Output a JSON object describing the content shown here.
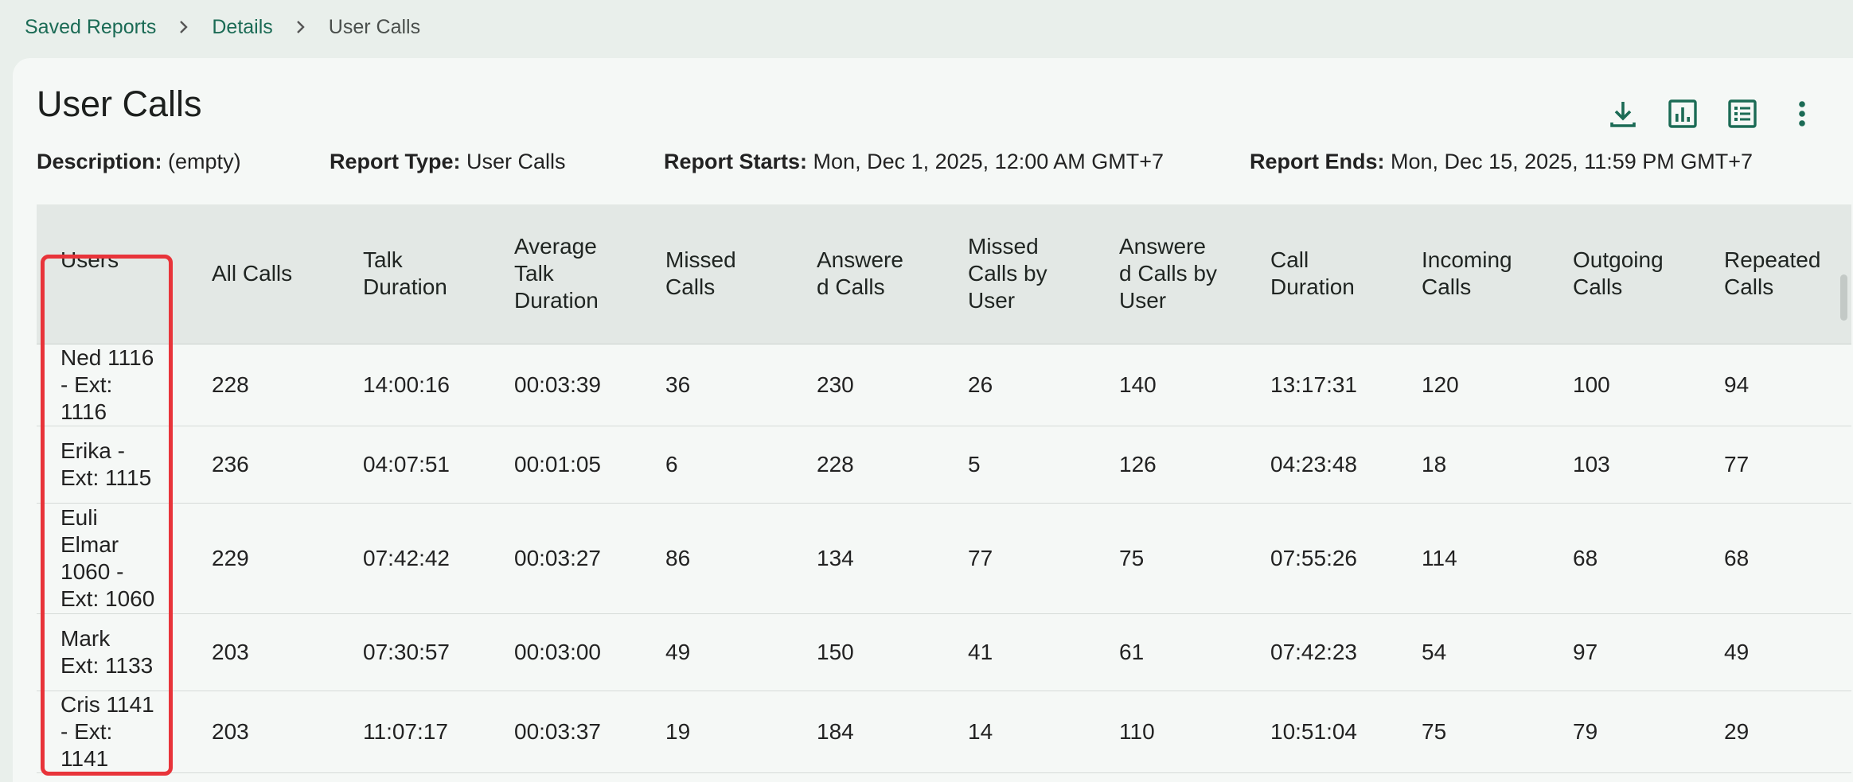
{
  "breadcrumb": {
    "items": [
      "Saved Reports",
      "Details"
    ],
    "current": "User Calls"
  },
  "header": {
    "title": "User Calls",
    "actions": [
      {
        "icon": "download-icon"
      },
      {
        "icon": "bar-chart-icon"
      },
      {
        "icon": "list-view-icon"
      },
      {
        "icon": "more-vertical-icon"
      }
    ]
  },
  "meta": {
    "description_label": "Description:",
    "description_value": "(empty)",
    "type_label": "Report Type:",
    "type_value": "User Calls",
    "starts_label": "Report Starts:",
    "starts_value": "Mon, Dec 1, 2025, 12:00 AM GMT+7",
    "ends_label": "Report Ends:",
    "ends_value": "Mon, Dec 15, 2025, 11:59 PM GMT+7"
  },
  "table": {
    "columns": [
      [
        "Users"
      ],
      [
        "All Calls"
      ],
      [
        "Talk",
        "Duration"
      ],
      [
        "Average",
        "Talk",
        "Duration"
      ],
      [
        "Missed",
        "Calls"
      ],
      [
        "Answere",
        "d Calls"
      ],
      [
        "Missed",
        "Calls by",
        "User"
      ],
      [
        "Answere",
        "d Calls by",
        "User"
      ],
      [
        "Call",
        "Duration"
      ],
      [
        "Incoming",
        "Calls"
      ],
      [
        "Outgoing",
        "Calls"
      ],
      [
        "Repeated",
        "Calls"
      ]
    ],
    "rows": [
      {
        "user": [
          "Ned 1116",
          "- Ext:",
          "1116"
        ],
        "cells": [
          "228",
          "14:00:16",
          "00:03:39",
          "36",
          "230",
          "26",
          "140",
          "13:17:31",
          "120",
          "100",
          "94"
        ]
      },
      {
        "user": [
          "Erika -",
          "Ext: 1115"
        ],
        "cells": [
          "236",
          "04:07:51",
          "00:01:05",
          "6",
          "228",
          "5",
          "126",
          "04:23:48",
          "18",
          "103",
          "77"
        ]
      },
      {
        "user": [
          "Euli",
          "Elmar",
          "1060 -",
          "Ext: 1060"
        ],
        "cells": [
          "229",
          "07:42:42",
          "00:03:27",
          "86",
          "134",
          "77",
          "75",
          "07:55:26",
          "114",
          "68",
          "68"
        ]
      },
      {
        "user": [
          "Mark",
          "Ext: 1133"
        ],
        "cells": [
          "203",
          "07:30:57",
          "00:03:00",
          "49",
          "150",
          "41",
          "61",
          "07:42:23",
          "54",
          "97",
          "49"
        ]
      },
      {
        "user": [
          "Cris 1141",
          "- Ext:",
          "1141"
        ],
        "cells": [
          "203",
          "11:07:17",
          "00:03:37",
          "19",
          "184",
          "14",
          "110",
          "10:51:04",
          "75",
          "79",
          "29"
        ]
      }
    ]
  },
  "colors": {
    "accent": "#1b6b55",
    "highlight": "#e8343a",
    "background": "#e9efeb",
    "card": "#f5f8f6",
    "header_row": "#e3e8e5"
  }
}
